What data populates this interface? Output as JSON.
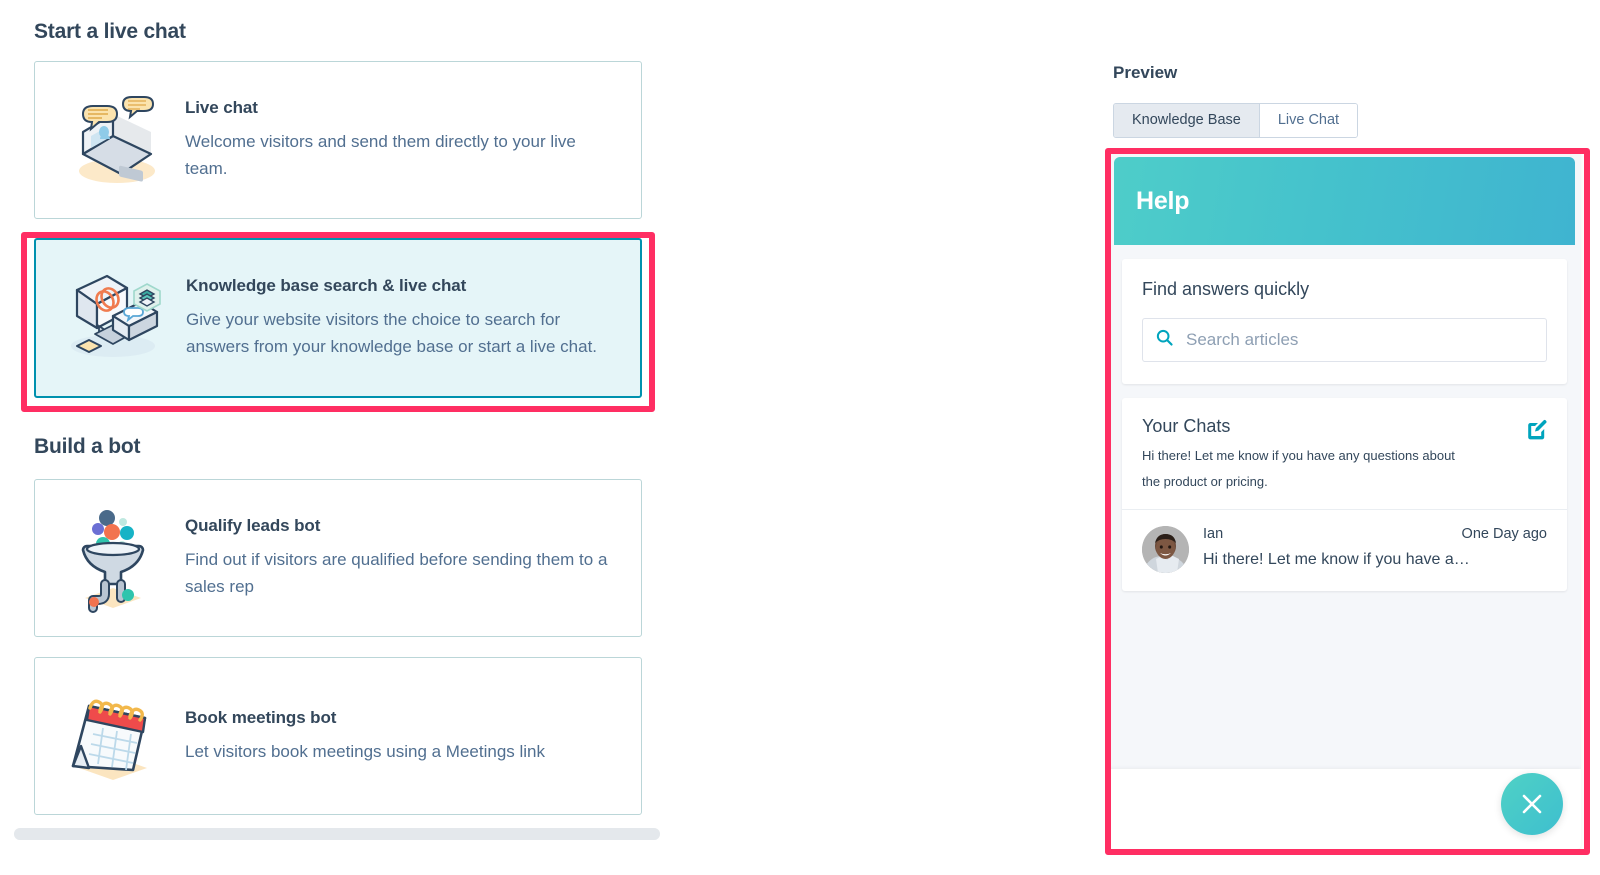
{
  "colors": {
    "annotation": "#ff2e63",
    "selected_border": "#0091ae",
    "selected_bg": "#e5f5f8",
    "text_dark": "#33475b",
    "text_muted": "#516f90",
    "widget_header_start": "#4ecdc9",
    "widget_header_end": "#3fb4d0"
  },
  "left_panel": {
    "sections": [
      {
        "heading": "Start a live chat",
        "cards": [
          {
            "title": "Live chat",
            "description": "Welcome visitors and send them directly to your live team.",
            "icon": "laptop-chat-bubbles-icon",
            "selected": false
          },
          {
            "title": "Knowledge base search & live chat",
            "description": "Give your website visitors the choice to search for answers from your knowledge base or start a live chat.",
            "icon": "desktop-laptop-knowledge-icon",
            "selected": true
          }
        ]
      },
      {
        "heading": "Build a bot",
        "cards": [
          {
            "title": "Qualify leads bot",
            "description": "Find out if visitors are qualified before sending them to a sales rep",
            "icon": "funnel-leads-icon",
            "selected": false
          },
          {
            "title": "Book meetings bot",
            "description": "Let visitors book meetings using a Meetings link",
            "icon": "desk-calendar-icon",
            "selected": false
          }
        ]
      }
    ]
  },
  "preview": {
    "label": "Preview",
    "tabs": [
      {
        "label": "Knowledge Base",
        "active": true
      },
      {
        "label": "Live Chat",
        "active": false
      }
    ],
    "widget": {
      "header_title": "Help",
      "knowledge_base": {
        "heading": "Find answers quickly",
        "search_placeholder": "Search articles",
        "search_value": "",
        "search_icon": "search-icon"
      },
      "chats": {
        "title": "Your Chats",
        "subtitle": "Hi there! Let me know if you have any questions about the product or pricing.",
        "compose_icon": "compose-icon",
        "threads": [
          {
            "name": "Ian",
            "time": "One Day ago",
            "snippet": "Hi there! Let me know if you have a…",
            "avatar": "avatar"
          }
        ]
      },
      "close_button_icon": "close-icon"
    }
  }
}
